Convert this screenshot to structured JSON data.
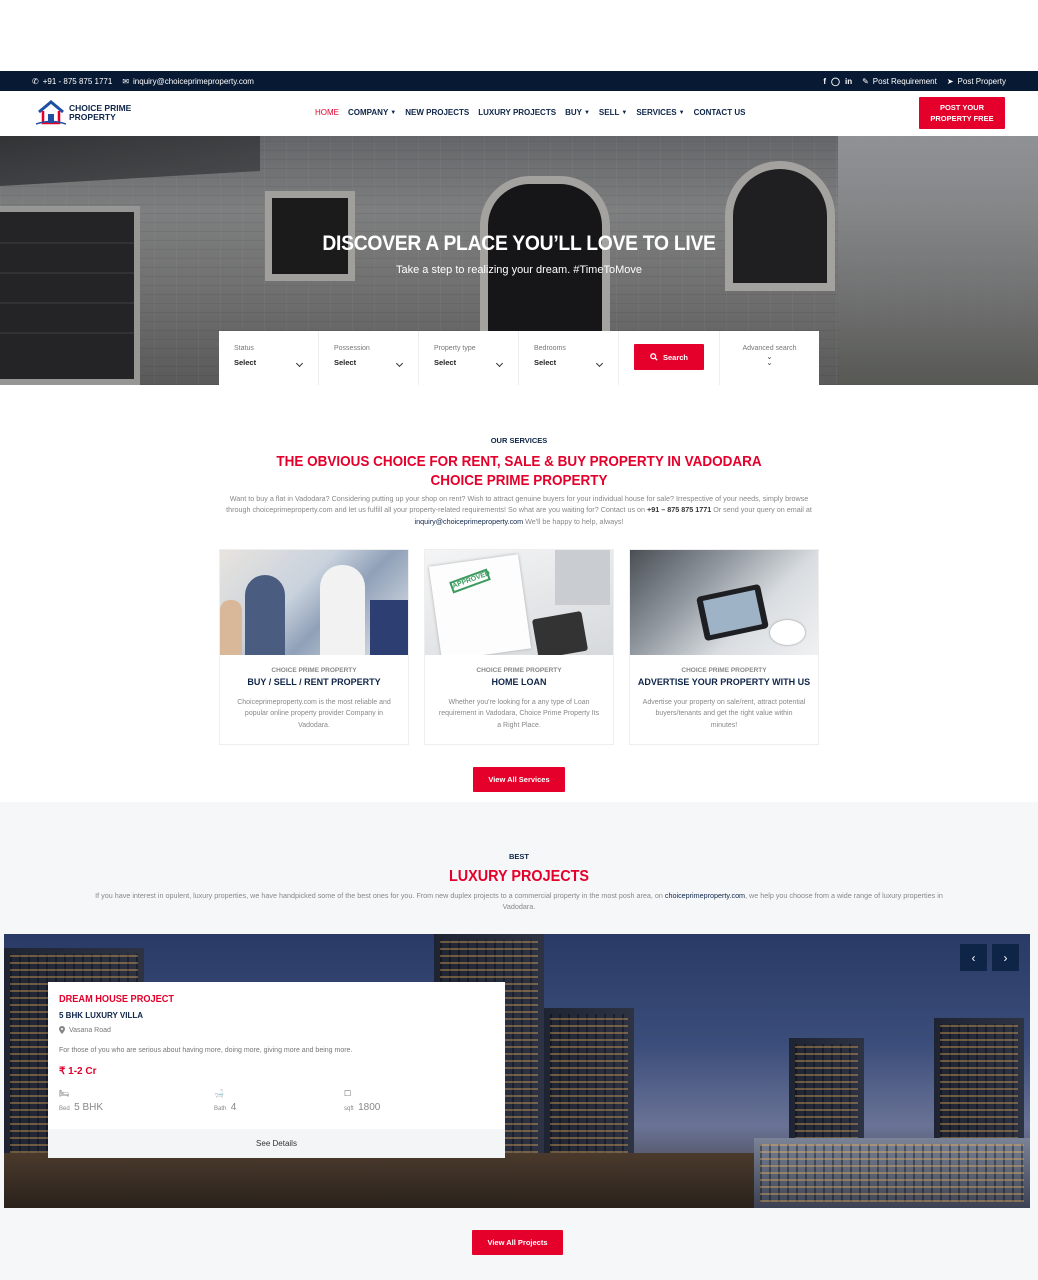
{
  "topbar": {
    "phone": "+91 - 875 875 1771",
    "email": "inquiry@choiceprimeproperty.com",
    "social": [
      "facebook-icon",
      "instagram-icon",
      "linkedin-icon"
    ],
    "post_requirement": "Post Requirement",
    "post_property": "Post Property"
  },
  "brand": {
    "name_line1": "CHOICE PRIME",
    "name_line2": "PROPERTY"
  },
  "nav": {
    "items": [
      {
        "label": "HOME",
        "active": true,
        "dropdown": false
      },
      {
        "label": "COMPANY",
        "dropdown": true
      },
      {
        "label": "NEW PROJECTS",
        "dropdown": false
      },
      {
        "label": "LUXURY PROJECTS",
        "dropdown": false
      },
      {
        "label": "BUY",
        "dropdown": true
      },
      {
        "label": "SELL",
        "dropdown": true
      },
      {
        "label": "SERVICES",
        "dropdown": true
      },
      {
        "label": "CONTACT US",
        "dropdown": false
      }
    ],
    "cta_line1": "POST YOUR",
    "cta_line2": "PROPERTY FREE"
  },
  "hero": {
    "title": "DISCOVER A PLACE YOU’LL LOVE TO LIVE",
    "subtitle": "Take a step to realizing your dream. #TimeToMove"
  },
  "search": {
    "fields": [
      {
        "label": "Status",
        "value": "Select"
      },
      {
        "label": "Possession",
        "value": "Select"
      },
      {
        "label": "Property type",
        "value": "Select"
      },
      {
        "label": "Bedrooms",
        "value": "Select"
      }
    ],
    "button": "Search",
    "advanced": "Advanced search"
  },
  "services": {
    "eyebrow": "OUR SERVICES",
    "title_line1": "THE OBVIOUS CHOICE FOR RENT, SALE & BUY PROPERTY IN VADODARA",
    "title_line2": "CHOICE PRIME PROPERTY",
    "text_part1": "Want to buy a flat in Vadodara? Considering putting up your shop on rent? Wish to attract genuine buyers for your individual house for sale? Irrespective of your needs, simply browse through choiceprimeproperty.com and let us fulfill all your property-related requirements! So what are you waiting for? Contact us on ",
    "text_phone": "+91 – 875 875 1771",
    "text_part2": " Or send your query on email at ",
    "text_email": "inquiry@choiceprimeproperty.com",
    "text_part3": " We'll be happy to help, always!",
    "cards": [
      {
        "brand": "CHOICE PRIME PROPERTY",
        "title": "BUY / SELL / RENT PROPERTY",
        "desc": "Choiceprimeproperty.com is the most reliable and popular online property provider Company in Vadodara."
      },
      {
        "brand": "CHOICE PRIME PROPERTY",
        "title": "HOME LOAN",
        "desc": "Whether you're looking for a any type of Loan requirement in Vadodara, Choice Prime Property Its a Right Place."
      },
      {
        "brand": "CHOICE PRIME PROPERTY",
        "title": "ADVERTISE YOUR PROPERTY WITH US",
        "desc": "Advertise your property on sale/rent, attract potential buyers/tenants and get the right value within minutes!"
      }
    ],
    "button": "View All Services"
  },
  "luxury": {
    "eyebrow": "BEST",
    "title": "LUXURY PROJECTS",
    "text_part1": "If you have interest in opulent, luxury properties, we have handpicked some of the best ones for you. From new duplex projects to a commercial property in the most posh area, on ",
    "text_link": "choiceprimeproperty.com",
    "text_part2": ", we help you choose from a wide range of luxury properties in Vadodara.",
    "project": {
      "name": "DREAM HOUSE PROJECT",
      "type": "5 BHK LUXURY VILLA",
      "location": "Vasana Road",
      "desc": "For those of you who are serious about having more, doing more, giving more and being more.",
      "price_symbol": "₹",
      "price": "1-2 Cr",
      "features": [
        {
          "icon": "bed-icon",
          "label": "Bed",
          "value": "5 BHK"
        },
        {
          "icon": "bath-icon",
          "label": "Bath",
          "value": "4"
        },
        {
          "icon": "area-icon",
          "label": "sqft",
          "value": "1800"
        }
      ],
      "details": "See Details"
    },
    "prev": "‹",
    "next": "›",
    "button": "View All Projects"
  }
}
